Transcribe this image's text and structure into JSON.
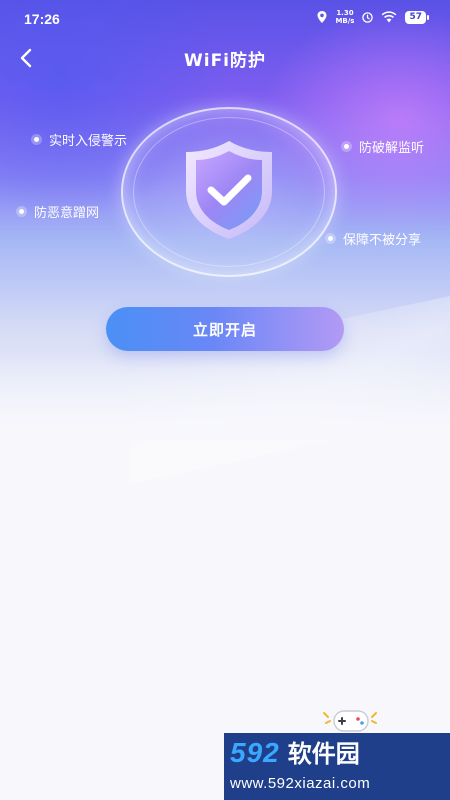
{
  "status_bar": {
    "time": "17:26",
    "net_speed_value": "1.30",
    "net_speed_unit": "MB/s",
    "battery": "57",
    "icons": [
      "location-icon",
      "do-not-disturb-icon",
      "wifi-icon",
      "battery-icon"
    ]
  },
  "header": {
    "back_icon": "chevron-left-icon",
    "title": "WiFi防护"
  },
  "protection": {
    "shield_icon": "shield-check-icon",
    "features": [
      {
        "label": "实时入侵警示"
      },
      {
        "label": "防破解监听"
      },
      {
        "label": "防恶意蹭网"
      },
      {
        "label": "保障不被分享"
      }
    ]
  },
  "actions": {
    "start_label": "立即开启"
  },
  "watermark": {
    "number": "592",
    "name": "软件园",
    "url": "www.592xiazai.com"
  },
  "colors": {
    "accent_blue": "#4a90f5",
    "accent_purple": "#7d5ef0",
    "watermark_bg": "#1f3f8a",
    "watermark_blue": "#3aa8ff"
  }
}
